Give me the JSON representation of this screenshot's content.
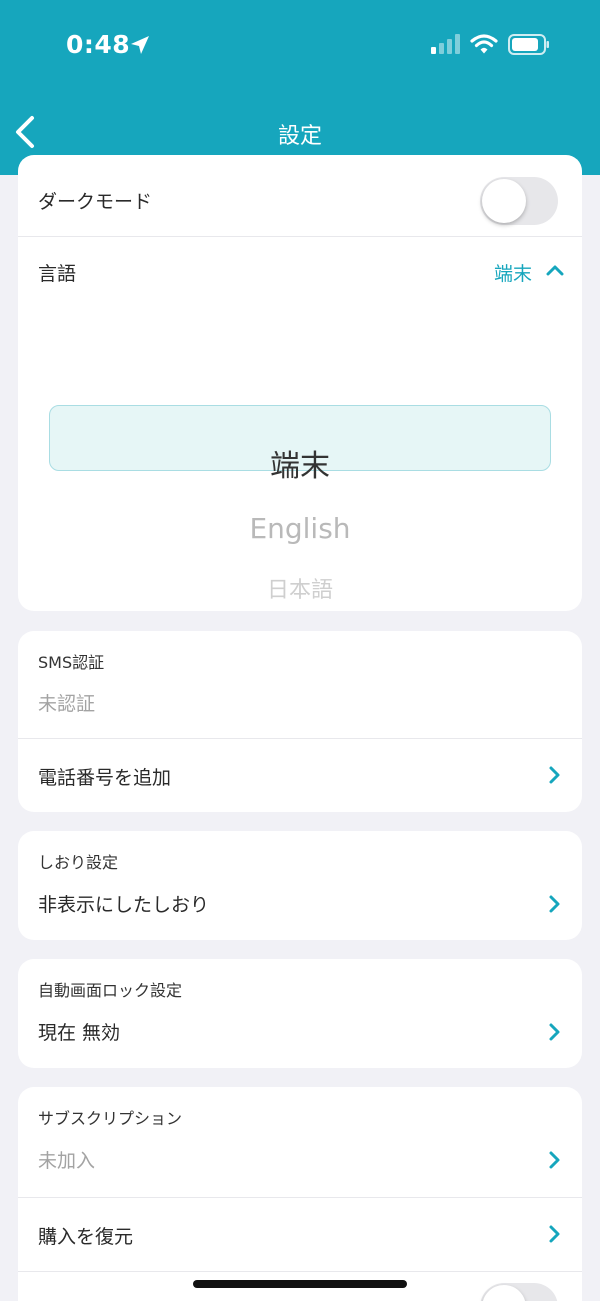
{
  "theme": {
    "accent": "#16a6bd"
  },
  "status_bar": {
    "time": "0:48",
    "icons": [
      "location-arrow-icon",
      "cellular-signal-icon",
      "wifi-icon",
      "battery-icon"
    ]
  },
  "nav": {
    "title": "設定",
    "back_icon": "chevron-left-icon"
  },
  "display": {
    "dark_mode_label": "ダークモード",
    "dark_mode_on": false,
    "language_label": "言語",
    "language_value": "端末",
    "picker_options": [
      "端末",
      "English",
      "日本語"
    ],
    "picker_selected": "端末"
  },
  "sms": {
    "title": "SMS認証",
    "status": "未認証",
    "add_phone_label": "電話番号を追加"
  },
  "bookmarks": {
    "title": "しおり設定",
    "hidden_label": "非表示にしたしおり"
  },
  "auto_lock": {
    "title": "自動画面ロック設定",
    "status": "現在 無効"
  },
  "subscription": {
    "title": "サブスクリプション",
    "status": "未加入",
    "restore_label": "購入を復元"
  }
}
